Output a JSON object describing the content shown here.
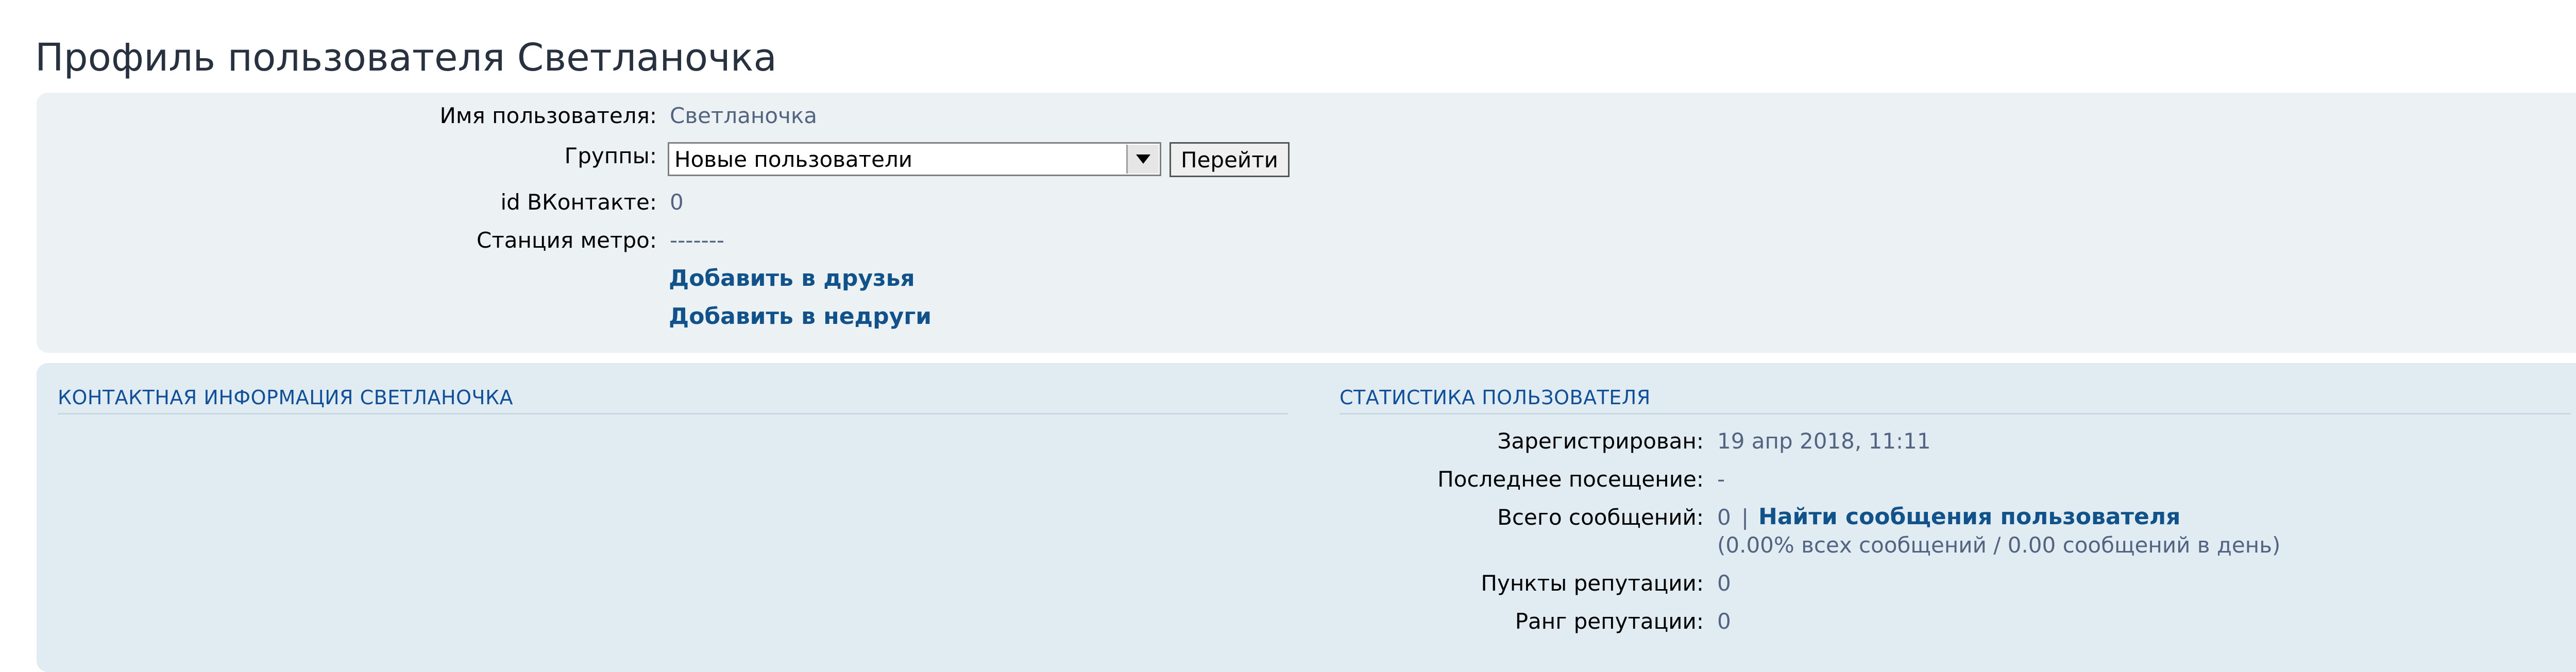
{
  "page": {
    "title": "Профиль пользователя Светланочка"
  },
  "profile": {
    "username_label": "Имя пользователя:",
    "username_value": "Светланочка",
    "groups_label": "Группы:",
    "groups_selected": "Новые пользователи",
    "go_button": "Перейти",
    "vk_label": "id ВКонтакте:",
    "vk_value": "0",
    "metro_label": "Станция метро:",
    "metro_value": "-------",
    "add_friend": "Добавить в друзья",
    "add_foe": "Добавить в недруги"
  },
  "contact": {
    "heading": "КОНТАКТНАЯ ИНФОРМАЦИЯ СВЕТЛАНОЧКА"
  },
  "stats": {
    "heading": "СТАТИСТИКА ПОЛЬЗОВАТЕЛЯ",
    "registered_label": "Зарегистрирован:",
    "registered_value": "19 апр 2018, 11:11",
    "last_visit_label": "Последнее посещение:",
    "last_visit_value": "-",
    "posts_label": "Всего сообщений:",
    "posts_value": "0",
    "posts_separator": "|",
    "find_posts": "Найти сообщения пользователя",
    "posts_detail": "(0.00% всех сообщений / 0.00 сообщений в день)",
    "rep_points_label": "Пункты репутации:",
    "rep_points_value": "0",
    "rep_rank_label": "Ранг репутации:",
    "rep_rank_value": "0"
  },
  "colors": {
    "panel_top": "#ECF1F3",
    "panel_bottom": "#E1EBF2",
    "link": "#105289",
    "heading": "#115098",
    "value_text": "#536482"
  },
  "icons": {
    "select_arrow": "triangle-down-icon"
  }
}
